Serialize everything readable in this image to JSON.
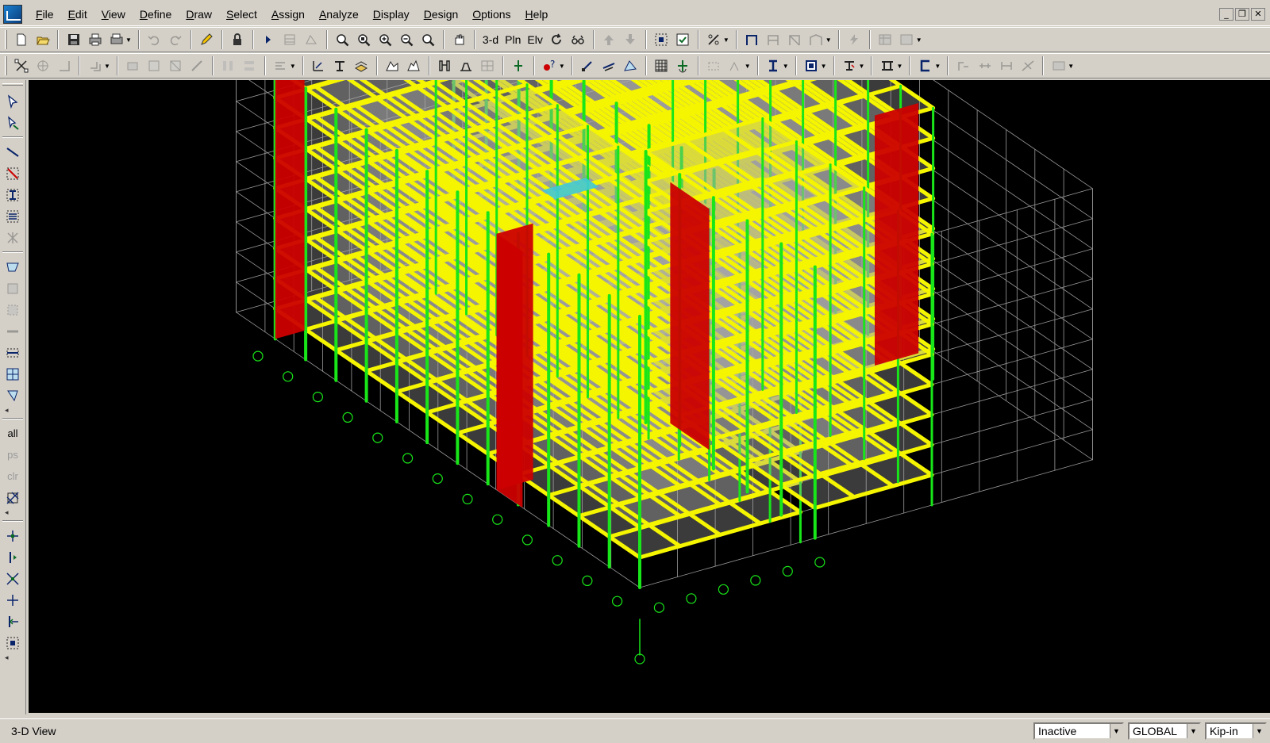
{
  "menu": {
    "items": [
      "File",
      "Edit",
      "View",
      "Define",
      "Draw",
      "Select",
      "Assign",
      "Analyze",
      "Display",
      "Design",
      "Options",
      "Help"
    ]
  },
  "toolbar1": {
    "view_3d_label": "3-d",
    "plan_label": "Pln",
    "elev_label": "Elv",
    "icons": [
      "new-model-icon",
      "open-icon",
      "save-icon",
      "print-icon",
      "print-tables-icon",
      "undo-icon",
      "redo-icon",
      "refresh-icon",
      "lock-icon",
      "run-analysis-icon",
      "zoom-window-icon",
      "zoom-restore-icon",
      "zoom-in-icon",
      "zoom-out-icon",
      "pan-icon",
      "rotate-icon",
      "perspective-icon",
      "move-up-icon",
      "move-down-icon",
      "object-shrink-icon",
      "set-building-view-icon"
    ]
  },
  "toolbar2": {
    "icons": [
      "select-icon",
      "pointer-icon",
      "reshape-icon",
      "draw-line-icon",
      "frame-icon",
      "wall-icon",
      "area-icon",
      "grid-icon",
      "snap-icon"
    ]
  },
  "left_toolbar": {
    "select_all_label": "all",
    "prev_select_label": "ps",
    "clear_select_label": "clr"
  },
  "statusbar": {
    "view_label": "3-D View",
    "story_option": "Inactive",
    "coord_system": "GLOBAL",
    "units": "Kip-in"
  },
  "colors": {
    "beam": "#f5f500",
    "column": "#19e619",
    "wall": "#cc0000",
    "slab": "#a9a9a9",
    "grid": "#9a9a9a",
    "axis_bubble": "#19e619",
    "stair_highlight": "#40c8d8"
  }
}
